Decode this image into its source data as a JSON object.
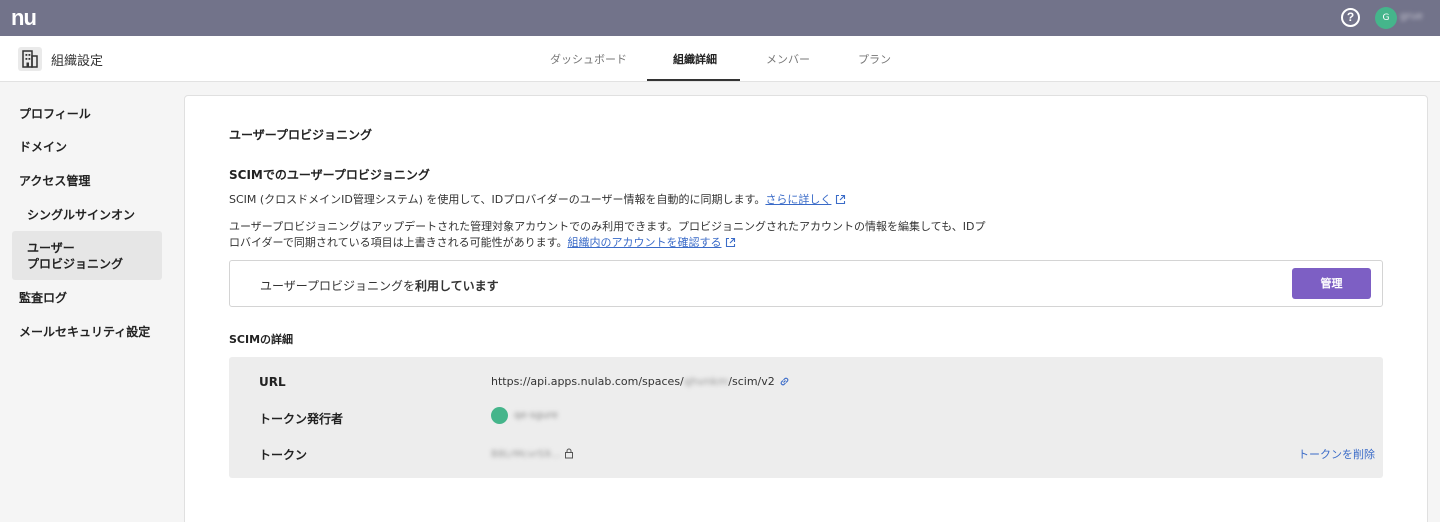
{
  "topbar": {
    "logo": "nu",
    "help_icon": "?",
    "user_avatar_initial": "G",
    "user_name": "grue"
  },
  "subheader": {
    "title": "組織設定",
    "tabs": [
      {
        "label": "ダッシュボード",
        "active": false
      },
      {
        "label": "組織詳細",
        "active": true
      },
      {
        "label": "メンバー",
        "active": false
      },
      {
        "label": "プラン",
        "active": false
      }
    ]
  },
  "sidebar": {
    "items": [
      {
        "label": "プロフィール"
      },
      {
        "label": "ドメイン"
      },
      {
        "label": "アクセス管理"
      },
      {
        "label": "シングルサインオン"
      },
      {
        "label": "ユーザー\nプロビジョニング",
        "line1": "ユーザー",
        "line2": "プロビジョニング",
        "active": true
      },
      {
        "label": "監査ログ"
      },
      {
        "label": "メールセキュリティ設定"
      }
    ]
  },
  "main": {
    "heading": "ユーザープロビジョニング",
    "scim_heading": "SCIMでのユーザープロビジョニング",
    "desc1_text": "SCIM (クロスドメインID管理システム) を使用して、IDプロバイダーのユーザー情報を自動的に同期します。",
    "desc1_link": "さらに詳しく",
    "desc2_line1": "ユーザープロビジョニングはアップデートされた管理対象アカウントでのみ利用できます。プロビジョニングされたアカウントの情報を編集しても、IDプ",
    "desc2_line2": "ロバイダーで同期されている項目は上書きされる可能性があります。",
    "desc2_link": "組織内のアカウントを確認する",
    "status_prefix": "ユーザープロビジョニングを",
    "status_bold": "利用しています",
    "manage_button": "管理",
    "details_heading": "SCIMの詳細",
    "details": {
      "url_label": "URL",
      "url_prefix": "https://api.apps.nulab.com/spaces/",
      "url_masked": "qhvnkm",
      "url_suffix": "/scim/v2",
      "issuer_label": "トークン発行者",
      "issuer_name": "qe-sgure",
      "token_label": "トークン",
      "token_value": "B8LrMcvrS9...",
      "delete_link": "トークンを削除"
    }
  },
  "colors": {
    "topbar": "#72738a",
    "accent": "#7d5fc4",
    "link": "#3a6bc8",
    "avatar": "#45b58b"
  }
}
